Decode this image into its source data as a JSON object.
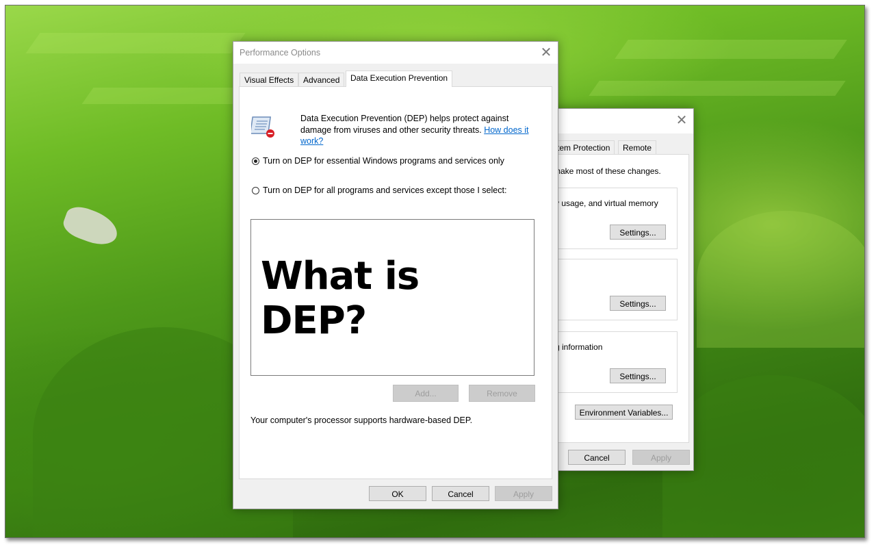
{
  "back_dialog": {
    "tabs": [
      "tem Protection",
      "Remote"
    ],
    "note": "make most of these changes.",
    "groups": [
      {
        "text": "y usage, and virtual memory",
        "button": "Settings..."
      },
      {
        "text": "",
        "button": "Settings..."
      },
      {
        "text": "g information",
        "button": "Settings..."
      }
    ],
    "env_button": "Environment Variables...",
    "cancel": "Cancel",
    "apply": "Apply"
  },
  "front_dialog": {
    "title": "Performance Options",
    "tabs": [
      "Visual Effects",
      "Advanced",
      "Data Execution Prevention"
    ],
    "active_tab": "Data Execution Prevention",
    "description": "Data Execution Prevention (DEP) helps protect against damage from viruses and other security threats.",
    "link": "How does it work?",
    "radio_essential": "Turn on DEP for essential Windows programs and services only",
    "radio_essential_selected": true,
    "radio_all": "Turn on DEP for all programs and services except those I select:",
    "overlay_text": "What is DEP?",
    "add_button": "Add...",
    "remove_button": "Remove",
    "processor_note": "Your computer's processor supports hardware-based DEP.",
    "ok": "OK",
    "cancel": "Cancel",
    "apply": "Apply"
  },
  "icons": {
    "close": "close-icon",
    "dep": "dep-shield-icon"
  }
}
